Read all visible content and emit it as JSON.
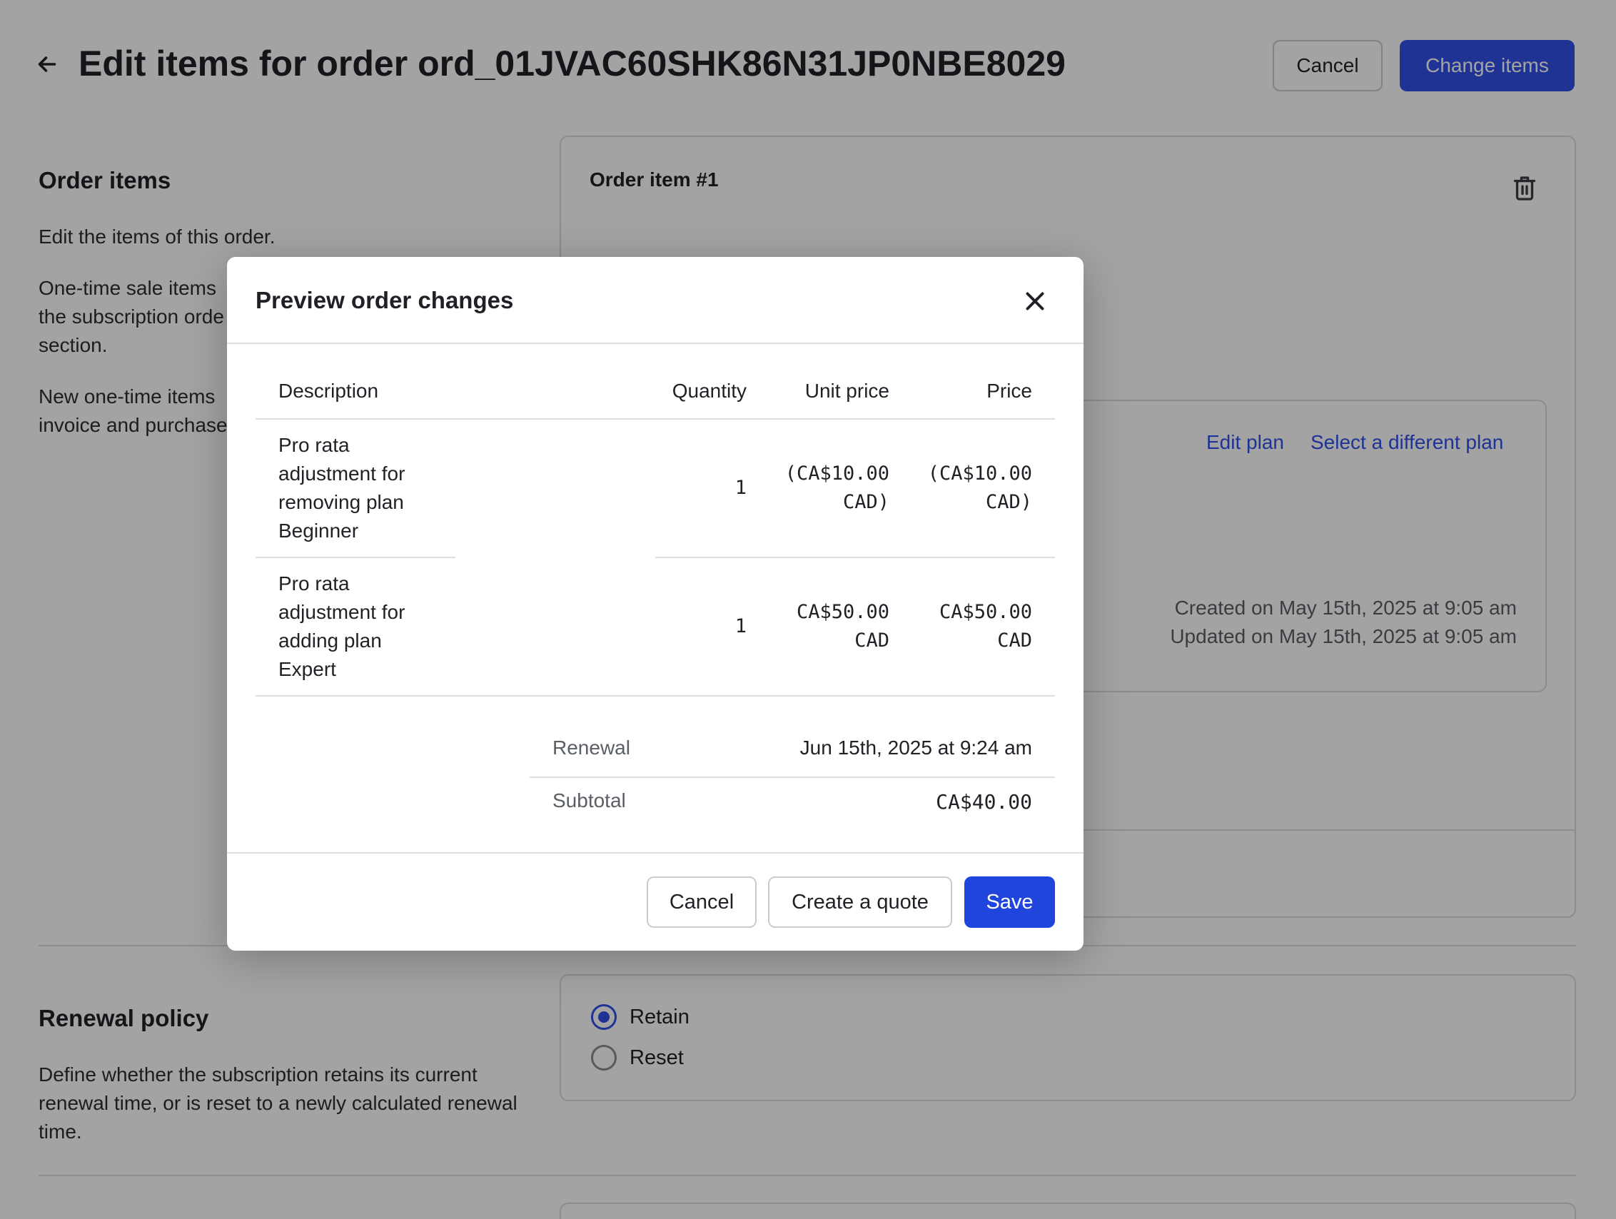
{
  "header": {
    "title": "Edit items for order ord_01JVAC60SHK86N31JP0NBE8029",
    "cancel_label": "Cancel",
    "change_items_label": "Change items"
  },
  "order_items_section": {
    "title": "Order items",
    "paragraphs": [
      "Edit the items of this order.",
      "One-time sale items\nthe subscription orde\nsection.",
      "New one-time items\ninvoice and purchase"
    ]
  },
  "order_item_card": {
    "title": "Order item #1",
    "edit_plan_label": "Edit plan",
    "select_plan_label": "Select a different plan",
    "created": "Created on May 15th, 2025 at 9:05 am",
    "updated": "Updated on May 15th, 2025 at 9:05 am"
  },
  "renewal_policy": {
    "title": "Renewal policy",
    "description": "Define whether the subscription retains its current renewal time, or is reset to a newly calculated renewal time.",
    "options": [
      {
        "label": "Retain",
        "checked": true
      },
      {
        "label": "Reset",
        "checked": false
      }
    ]
  },
  "modal": {
    "title": "Preview order changes",
    "columns": {
      "description": "Description",
      "quantity": "Quantity",
      "unit_price": "Unit price",
      "price": "Price"
    },
    "rows": [
      {
        "description": "Pro rata adjustment for removing plan Beginner",
        "quantity": "1",
        "unit_price_l1": "(CA$10.00",
        "unit_price_l2": "CAD)",
        "price_l1": "(CA$10.00",
        "price_l2": "CAD)"
      },
      {
        "description": "Pro rata adjustment for adding plan Expert",
        "quantity": "1",
        "unit_price_l1": "CA$50.00",
        "unit_price_l2": "CAD",
        "price_l1": "CA$50.00",
        "price_l2": "CAD"
      }
    ],
    "summary": {
      "renewal_label": "Renewal",
      "renewal_value": "Jun 15th, 2025 at 9:24 am",
      "subtotal_label": "Subtotal",
      "subtotal_value": "CA$40.00"
    },
    "buttons": {
      "cancel": "Cancel",
      "quote": "Create a quote",
      "save": "Save"
    }
  },
  "colors": {
    "primary": "#1f45dd",
    "link": "#2f50e6",
    "overlay": "rgba(0,0,0,0.36)"
  }
}
